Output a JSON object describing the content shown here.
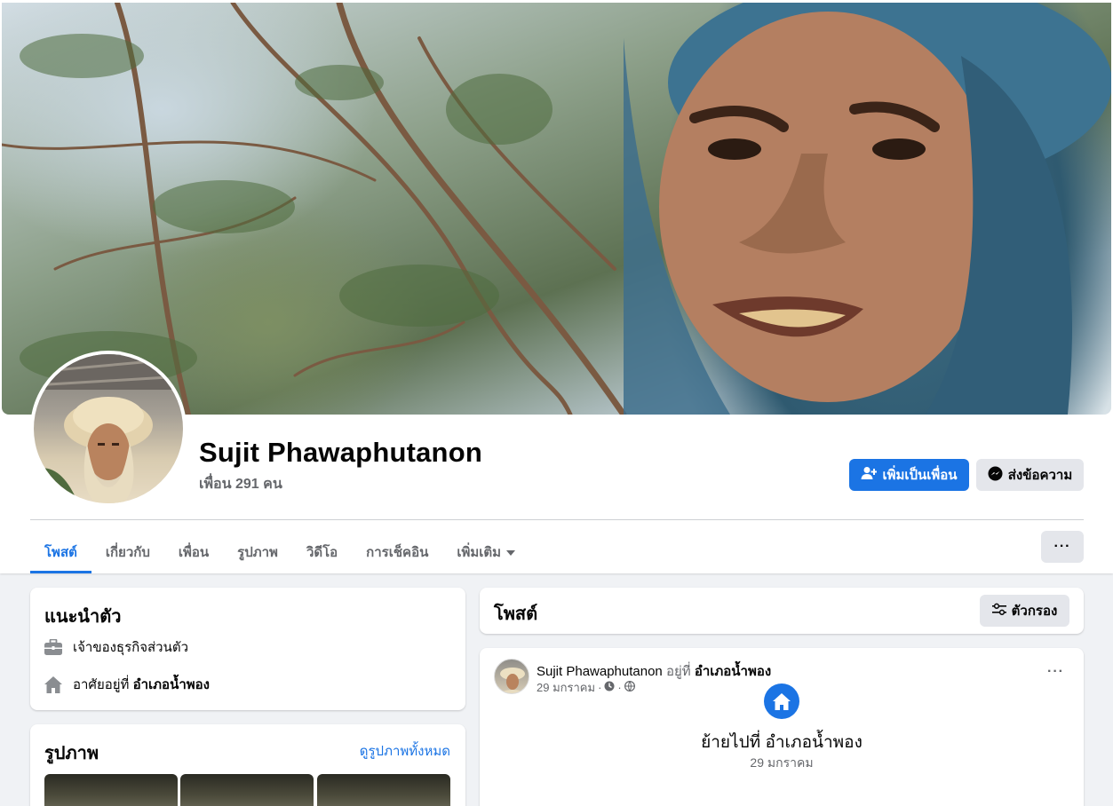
{
  "profile": {
    "name": "Sujit Phawaphutanon",
    "friends_text": "เพื่อน 291 คน"
  },
  "actions": {
    "add_friend": "เพิ่มเป็นเพื่อน",
    "message": "ส่งข้อความ",
    "more": "···"
  },
  "tabs": [
    {
      "label": "โพสต์",
      "active": true
    },
    {
      "label": "เกี่ยวกับ"
    },
    {
      "label": "เพื่อน"
    },
    {
      "label": "รูปภาพ"
    },
    {
      "label": "วิดีโอ"
    },
    {
      "label": "การเช็คอิน"
    },
    {
      "label": "เพิ่มเติม"
    }
  ],
  "intro": {
    "title": "แนะนำตัว",
    "business": "เจ้าของธุรกิจส่วนตัว",
    "lives_prefix": "อาศัยอยู่ที่ ",
    "lives_place": "อำเภอน้ำพอง"
  },
  "photos": {
    "title": "รูปภาพ",
    "see_all": "ดูรูปภาพทั้งหมด"
  },
  "posts": {
    "title": "โพสต์",
    "filter": "ตัวกรอง"
  },
  "post": {
    "author": "Sujit Phawaphutanon",
    "at": " อยู่ที่ ",
    "place": "อำเภอน้ำพอง",
    "date": "29 มกราคม",
    "more": "···",
    "life_event": "ย้ายไปที่ อำเภอน้ำพอง",
    "life_date": "29 มกราคม"
  },
  "colors": {
    "accent": "#1b74e4",
    "secondary_button": "#e4e6eb",
    "page_bg": "#f0f2f5",
    "muted_text": "#65676b"
  },
  "icons": {
    "add_friend": "person-plus-icon",
    "message": "messenger-icon",
    "business": "briefcase-icon",
    "home": "house-icon",
    "filter": "sliders-icon",
    "clock": "clock-icon",
    "globe": "globe-icon",
    "dropdown": "caret-down-icon"
  }
}
